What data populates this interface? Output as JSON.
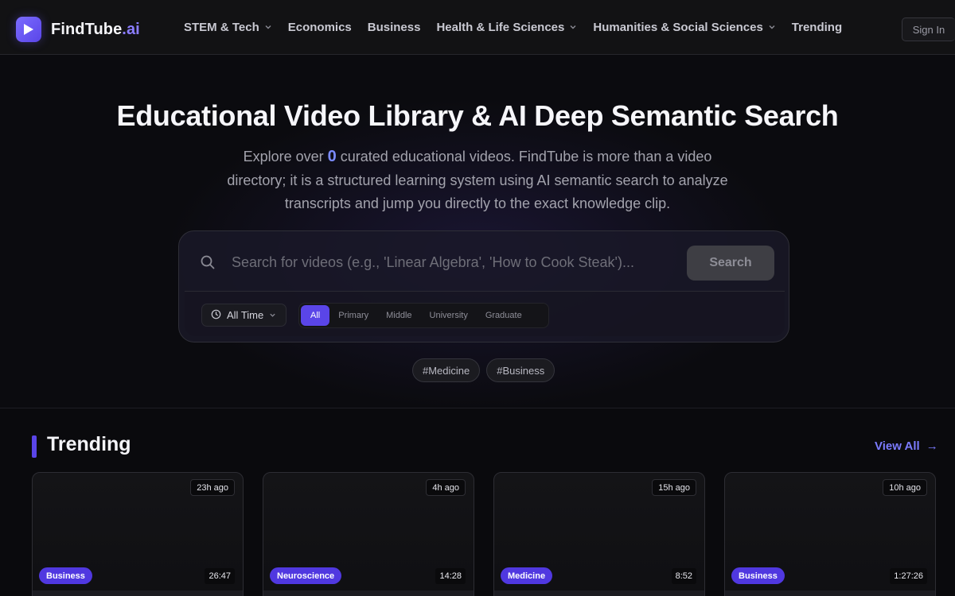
{
  "brand": {
    "name": "FindTube",
    "suffix": ".ai",
    "accent": "#5a45e8"
  },
  "nav": [
    {
      "label": "STEM & Tech",
      "has_dropdown": true
    },
    {
      "label": "Economics",
      "has_dropdown": false
    },
    {
      "label": "Business",
      "has_dropdown": false
    },
    {
      "label": "Health & Life Sciences",
      "has_dropdown": true
    },
    {
      "label": "Humanities & Social Sciences",
      "has_dropdown": true
    },
    {
      "label": "Trending",
      "has_dropdown": false
    }
  ],
  "auth": {
    "signin_label": "Sign In"
  },
  "hero": {
    "title": "Educational Video Library & AI Deep Semantic Search",
    "desc_prefix": "Explore over ",
    "video_count": "0",
    "desc_suffix": " curated educational videos. FindTube is more than a video directory; it is a structured learning system using AI semantic search to analyze transcripts and jump you directly to the exact knowledge clip."
  },
  "search": {
    "placeholder": "Search for videos (e.g., 'Linear Algebra', 'How to Cook Steak')...",
    "value": "",
    "button_label": "Search",
    "time_filter": "All Time",
    "levels": [
      "All",
      "Primary",
      "Middle",
      "University",
      "Graduate"
    ],
    "active_level": "All"
  },
  "tags": [
    "#Medicine",
    "#Business"
  ],
  "trending": {
    "title": "Trending",
    "view_all_label": "View All",
    "videos": [
      {
        "ago": "23h ago",
        "category": "Business",
        "duration": "26:47"
      },
      {
        "ago": "4h ago",
        "category": "Neuroscience",
        "duration": "14:28"
      },
      {
        "ago": "15h ago",
        "category": "Medicine",
        "duration": "8:52"
      },
      {
        "ago": "10h ago",
        "category": "Business",
        "duration": "1:27:26"
      }
    ]
  }
}
